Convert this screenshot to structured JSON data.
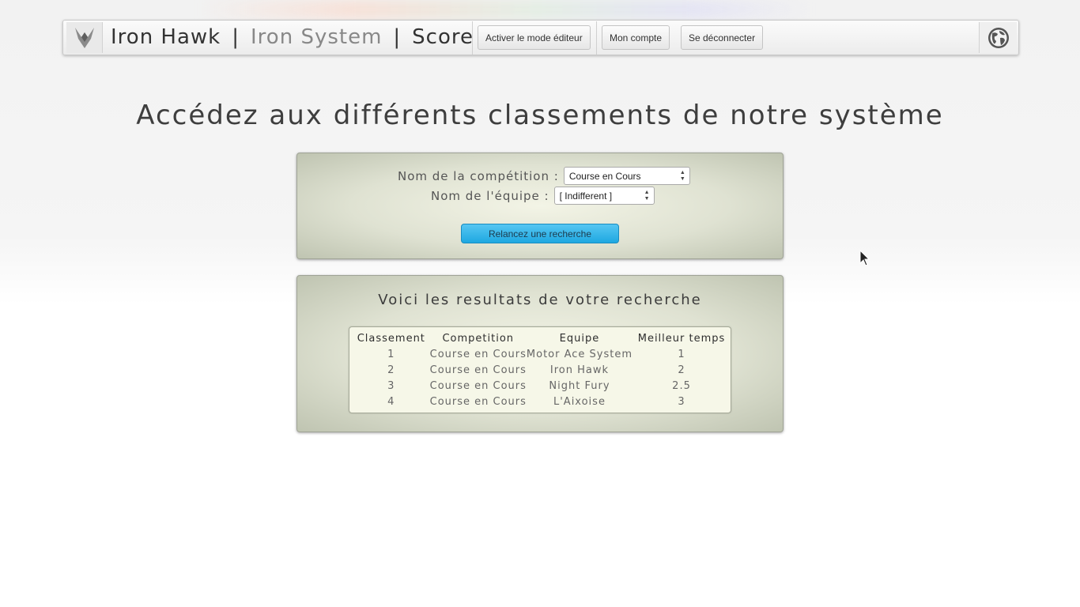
{
  "nav": {
    "brand_primary": "Iron Hawk",
    "separator": "|",
    "brand_secondary": "Iron System",
    "brand_section": "Score",
    "buttons": {
      "editor_mode": "Activer le mode éditeur",
      "account": "Mon compte",
      "logout": "Se déconnecter"
    },
    "icons": {
      "logo": "hawk-logo-icon",
      "globe": "globe-icon"
    }
  },
  "page": {
    "title": "Accédez aux différents classements de notre système"
  },
  "search": {
    "competition_label": "Nom de la compétition :",
    "competition_value": "Course en Cours",
    "team_label": "Nom de l'équipe :",
    "team_value": "[ Indifferent ]",
    "button_label": "Relancez une recherche",
    "button_color": "#1ea8e1"
  },
  "results": {
    "title": "Voici les resultats de votre recherche",
    "columns": [
      "Classement",
      "Competition",
      "Equipe",
      "Meilleur temps"
    ],
    "rows": [
      [
        "1",
        "Course en Cours",
        "Motor Ace System",
        "1"
      ],
      [
        "2",
        "Course en Cours",
        "Iron Hawk",
        "2"
      ],
      [
        "3",
        "Course en Cours",
        "Night Fury",
        "2.5"
      ],
      [
        "4",
        "Course en Cours",
        "L'Aixoise",
        "3"
      ]
    ]
  }
}
